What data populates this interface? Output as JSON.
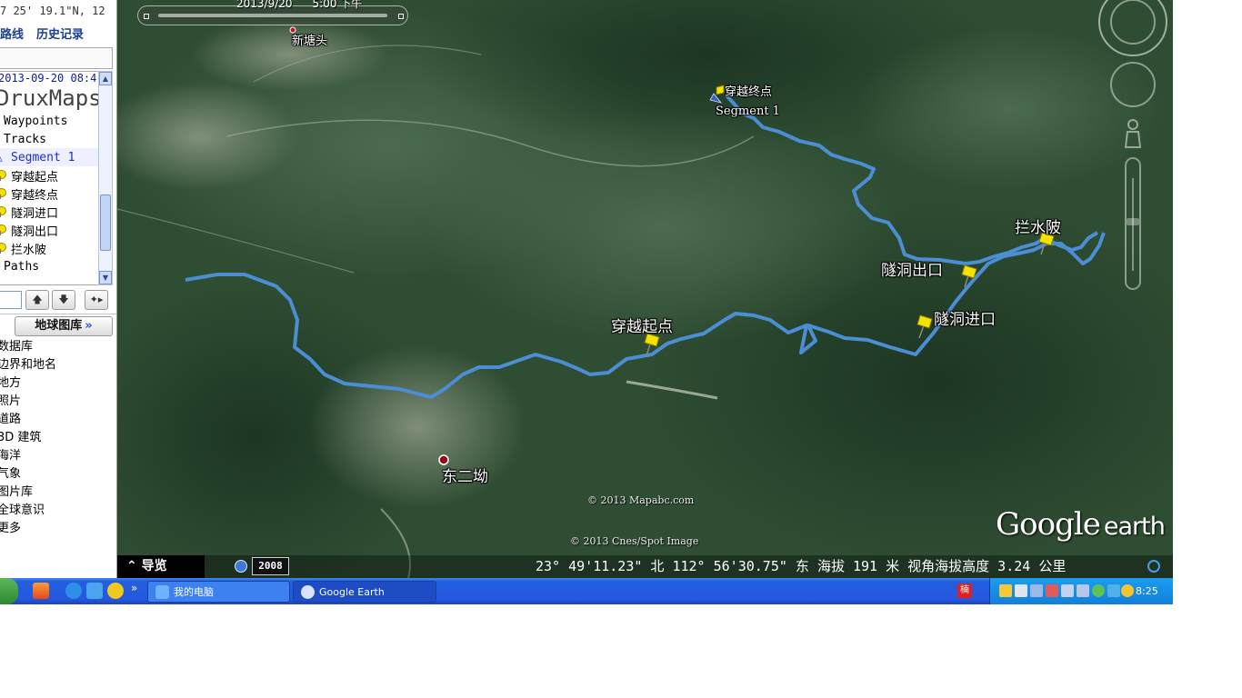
{
  "left_panel": {
    "coord_top": "7 25' 19.1\"N, 12",
    "links": [
      "路线",
      "历史记录"
    ],
    "tree": {
      "date": "2013-09-20 08:4",
      "title": "DruxMaps",
      "items": [
        {
          "label": "Waypoints",
          "icon": ""
        },
        {
          "label": "Tracks",
          "icon": ""
        },
        {
          "label": "Segment 1",
          "icon": "track-icon"
        },
        {
          "label": "穿越起点",
          "icon": "placemark-pin-icon"
        },
        {
          "label": "穿越终点",
          "icon": "placemark-pin-icon"
        },
        {
          "label": "隧洞进口",
          "icon": "placemark-pin-icon"
        },
        {
          "label": "隧洞出口",
          "icon": "placemark-pin-icon"
        },
        {
          "label": "拦水陂",
          "icon": "placemark-pin-icon"
        },
        {
          "label": "Paths",
          "icon": ""
        }
      ]
    },
    "layers_button": "地球图库",
    "layers_chevron": "»",
    "layers": [
      "数据库",
      "边界和地名",
      "地方",
      "照片",
      "道路",
      "3D 建筑",
      "海洋",
      "气象",
      "图片库",
      "全球意识",
      "更多"
    ]
  },
  "map": {
    "timeline": {
      "date": "2013/9/20",
      "time": "5:00 下午"
    },
    "places": {
      "xintangtou": "新塘头",
      "dongeraoo": "东二坳"
    },
    "track_labels": {
      "start": "穿越起点",
      "end": "穿越终点",
      "segment": "Segment 1",
      "tunnel_in": "隧洞进口",
      "tunnel_out": "隧洞出口",
      "dam": "拦水陂"
    },
    "copyright_1": "© 2013 Mapabc.com",
    "copyright_2": "© 2013 Cnes/Spot Image",
    "logo": {
      "google": "Google",
      "earth": "earth"
    },
    "track_color": "#4b8ed4",
    "pin_color": "#f4e200"
  },
  "status_bar": {
    "guide": "导览",
    "year": "2008",
    "text": "23° 49'11.23\" 北 112° 56'30.75\" 东 海拔   191 米   视角海拔高度   3.24 公里"
  },
  "taskbar": {
    "quicklaunch_more": "»",
    "tasks": [
      "我的电脑",
      "Google Earth"
    ],
    "ime": "楠",
    "clock": "8:25",
    "colors": {
      "bar": "#2458de",
      "tray": "#127fd9"
    }
  }
}
